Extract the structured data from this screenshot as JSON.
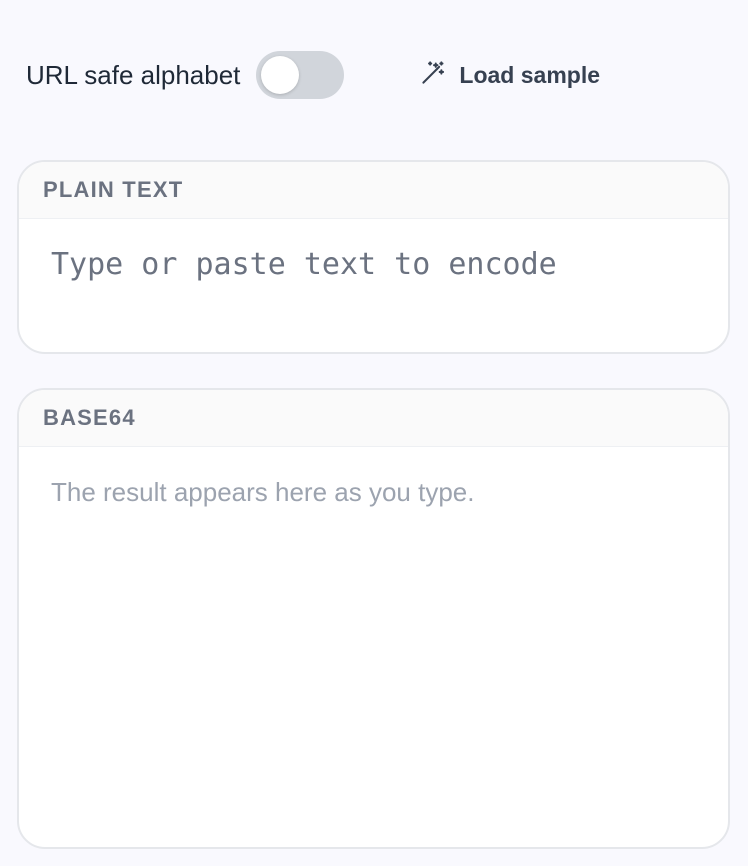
{
  "toolbar": {
    "url_safe_label": "URL safe alphabet",
    "url_safe_enabled": false,
    "load_sample_label": "Load sample",
    "load_sample_icon": "magic-wand-icon"
  },
  "plain_panel": {
    "title": "PLAIN TEXT",
    "value": "",
    "placeholder": "Type or paste text to encode"
  },
  "base64_panel": {
    "title": "BASE64",
    "value": "",
    "placeholder": "The result appears here as you type."
  },
  "colors": {
    "background": "#f9f9fe",
    "toggle_off": "#d1d5db",
    "panel_border": "#e5e7eb",
    "header_text": "#6b7280",
    "placeholder_text": "#9ca3af"
  }
}
